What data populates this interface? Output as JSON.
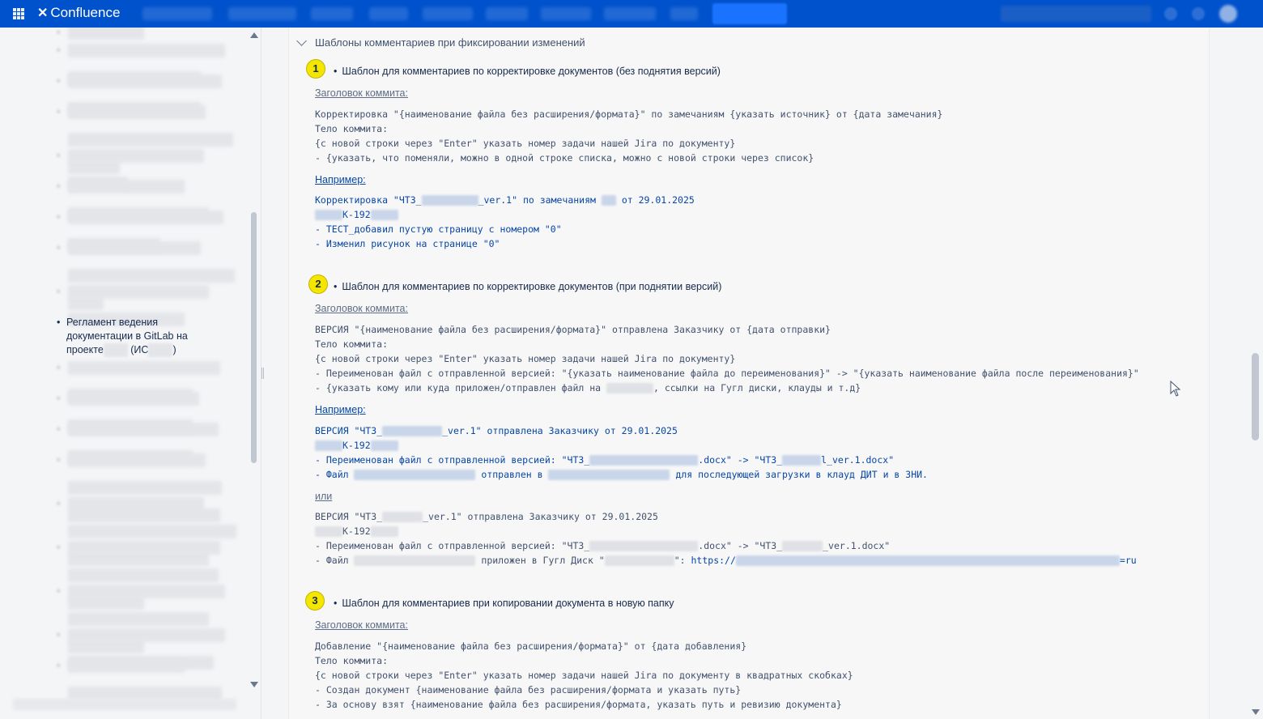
{
  "app": {
    "name": "Confluence"
  },
  "sidebar": {
    "current_item": {
      "line1": "Регламент ведения",
      "line2": "документации в GitLab на",
      "line3_prefix": "проекте",
      "line3_mid": "(ИС",
      "line3_suffix": ")"
    }
  },
  "expand": {
    "title": "Шаблоны комментариев при фиксировании изменений"
  },
  "sections": [
    {
      "badge": "1",
      "title": "Шаблон для комментариев по корректировке документов (без поднятия версий)",
      "commit_label": "Заголовок коммита:",
      "template_lines": [
        "Корректировка \"{наименование файла без расширения/формата}\" по замечаниям {указать источник} от {дата замечания}",
        "Тело коммита:",
        "{с новой строки через \"Enter\" указать номер задачи нашей Jira по документу}",
        "- {указать, что поменяли, можно в одной строке списка, можно с новой строки через список}"
      ],
      "example_label": "Например:",
      "example": {
        "l1_a": "Корректировка \"ЧТЗ_",
        "l1_b": "_ver.1\" по замечаниям ",
        "l1_c": " от 29.01.2025",
        "l2": "К-192",
        "l3": "- ТЕСТ_добавил пустую страницу с номером \"0\"",
        "l4": "- Изменил рисунок на странице \"0\""
      }
    },
    {
      "badge": "2",
      "title": "Шаблон для комментариев по корректировке документов (при поднятии версий)",
      "commit_label": "Заголовок коммита:",
      "template_lines": [
        "ВЕРСИЯ \"{наименование файла без расширения/формата}\" отправлена Заказчику от {дата отправки}",
        "Тело коммита:",
        "{с новой строки через \"Enter\" указать номер задачи нашей Jira по документу}",
        "- Переименован файл с отправленной версией: \"{указать наименование файла до переименования}\" -> \"{указать наименование файла после переименования}\""
      ],
      "template_last_a": "- {указать кому или куда приложен/отправлен файл на ",
      "template_last_b": ", ссылки на Гугл диски, клауды и т.д}",
      "example_label": "Например:",
      "example": {
        "l1_a": "ВЕРСИЯ \"ЧТЗ_",
        "l1_b": "_ver.1\" отправлена Заказчику от 29.01.2025",
        "l2": "К-192",
        "l3_a": "- Переименован файл с отправленной версией: \"ЧТЗ_",
        "l3_b": ".docx\" -> \"ЧТЗ_",
        "l3_c": "l_ver.1.docx\"",
        "l4_a": "- Файл ",
        "l4_b": " отправлен в ",
        "l4_c": " для последующей загрузки в клауд ДИТ и в ЗНИ."
      },
      "or_label": "или",
      "example2": {
        "l1_a": "ВЕРСИЯ \"ЧТЗ_",
        "l1_b": "_ver.1\" отправлена Заказчику от 29.01.2025",
        "l2": "К-192",
        "l3_a": "- Переименован файл с отправленной версией: \"ЧТЗ_",
        "l3_b": ".docx\" -> \"ЧТЗ_",
        "l3_c": "_ver.1.docx\"",
        "l4_a": "- Файл ",
        "l4_b": " приложен в Гугл Диск \"",
        "l4_c": "\": ",
        "l4_link_a": "https://",
        "l4_link_b": "=ru"
      }
    },
    {
      "badge": "3",
      "title": "Шаблон для комментариев при копировании документа в новую папку",
      "commit_label": "Заголовок коммита:",
      "template_lines": [
        "Добавление \"{наименование файла без расширения/формата}\" от {дата добавления}",
        "Тело коммита:",
        "{с новой строки через \"Enter\" указать номер задачи нашей Jira по документу в квадратных скобках}",
        "- Создан документ {наименование файла без расширения/формата и указать путь}",
        "- За основу взят {наименование файла без расширения/формата, указать путь и ревизию документа}"
      ]
    }
  ]
}
